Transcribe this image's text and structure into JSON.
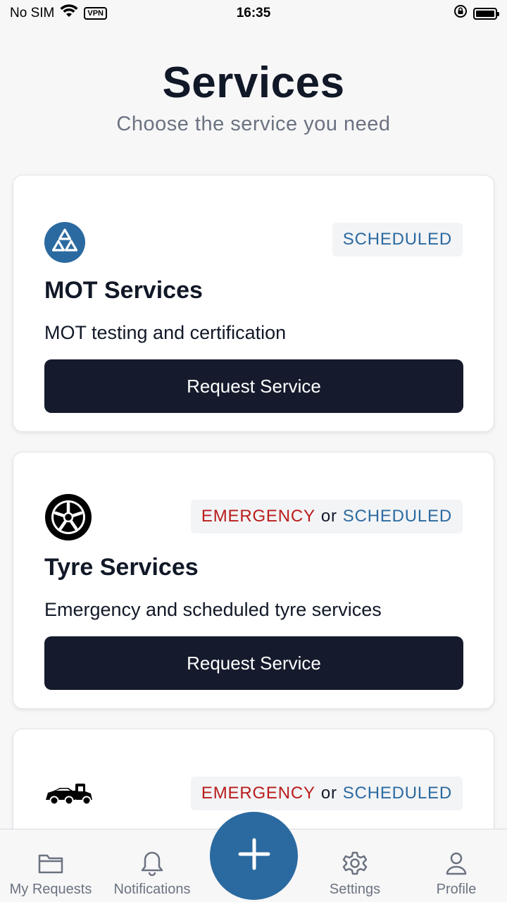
{
  "status_bar": {
    "carrier": "No SIM",
    "vpn": "VPN",
    "time": "16:35"
  },
  "header": {
    "title": "Services",
    "subtitle": "Choose the service you need"
  },
  "services": [
    {
      "icon": "mot-triangles-icon",
      "badge_scheduled": "SCHEDULED",
      "title": "MOT Services",
      "description": "MOT testing and certification",
      "button": "Request Service"
    },
    {
      "icon": "tyre-icon",
      "badge_emergency": "EMERGENCY",
      "badge_or": "or",
      "badge_scheduled": "SCHEDULED",
      "title": "Tyre Services",
      "description": "Emergency and scheduled tyre services",
      "button": "Request Service"
    },
    {
      "icon": "tow-truck-icon",
      "badge_emergency": "EMERGENCY",
      "badge_or": "or",
      "badge_scheduled": "SCHEDULED"
    }
  ],
  "bottom_nav": {
    "items": [
      {
        "label": "My Requests",
        "icon": "folder-icon"
      },
      {
        "label": "Notifications",
        "icon": "bell-icon"
      },
      {
        "label": "Settings",
        "icon": "gear-icon"
      },
      {
        "label": "Profile",
        "icon": "person-icon"
      }
    ],
    "fab_icon": "plus-icon"
  },
  "colors": {
    "accent": "#2b6aa0",
    "emergency": "#b91c1c",
    "button": "#151b2c"
  }
}
